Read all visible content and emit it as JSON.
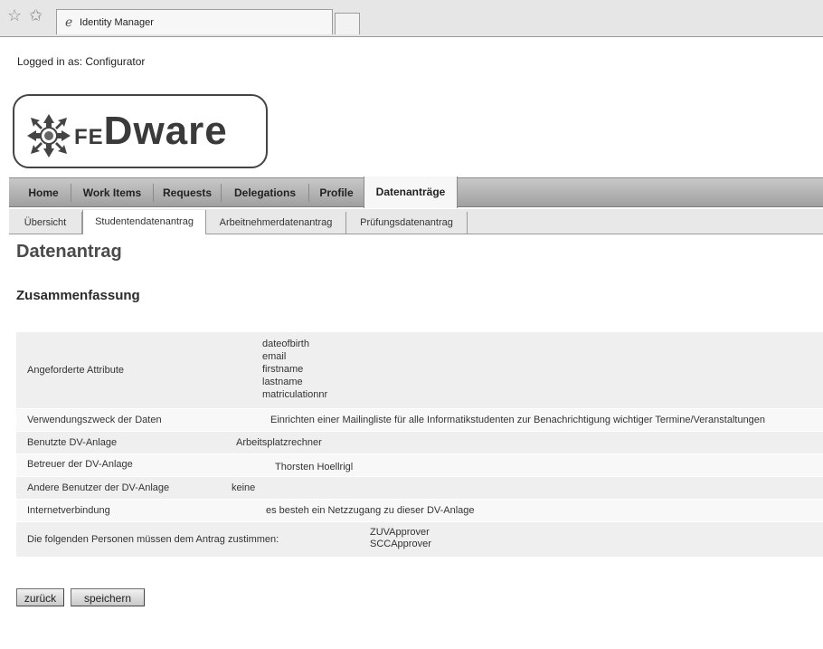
{
  "browser": {
    "tab_title": "Identity Manager",
    "favorites_icon": "star-icon",
    "add_favorites_icon": "star-add-icon",
    "tab_icon": "ie-icon"
  },
  "header": {
    "logged_in": "Logged in as: Configurator",
    "logo_text": "FEDware",
    "logo_icon": "fedware-logo-icon"
  },
  "main_nav": {
    "items": [
      {
        "label": "Home"
      },
      {
        "label": "Work Items"
      },
      {
        "label": "Requests"
      },
      {
        "label": "Delegations"
      },
      {
        "label": "Profile"
      },
      {
        "label": "Datenanträge",
        "active": true
      }
    ]
  },
  "sub_nav": {
    "items": [
      {
        "label": "Übersicht"
      },
      {
        "label": "Studentendatenantrag",
        "active": true
      },
      {
        "label": "Arbeitnehmerdatenantrag"
      },
      {
        "label": "Prüfungsdatenantrag"
      }
    ]
  },
  "page": {
    "title": "Datenantrag",
    "section_title": "Zusammenfassung"
  },
  "summary": {
    "rows": [
      {
        "label": "Angeforderte Attribute",
        "values": [
          "dateofbirth",
          "email",
          "firstname",
          "lastname",
          "matriculationnr"
        ]
      },
      {
        "label": "Verwendungszweck der Daten",
        "value": "Einrichten einer Mailingliste für alle Informatikstudenten zur Benachrichtigung wichtiger Termine/Veranstaltungen"
      },
      {
        "label": "Benutzte DV-Anlage",
        "value": "Arbeitsplatzrechner"
      },
      {
        "label": "Betreuer der DV-Anlage",
        "value": "Thorsten Hoellrigl"
      },
      {
        "label": "Andere Benutzer der DV-Anlage",
        "value": "keine"
      },
      {
        "label": "Internetverbindung",
        "value": "es besteh ein Netzzugang zu dieser DV-Anlage"
      },
      {
        "label": "Die folgenden Personen müssen dem Antrag zustimmen:",
        "values": [
          "ZUVApprover",
          "SCCApprover"
        ]
      }
    ]
  },
  "actions": {
    "back_label": "zurück",
    "save_label": "speichern"
  }
}
